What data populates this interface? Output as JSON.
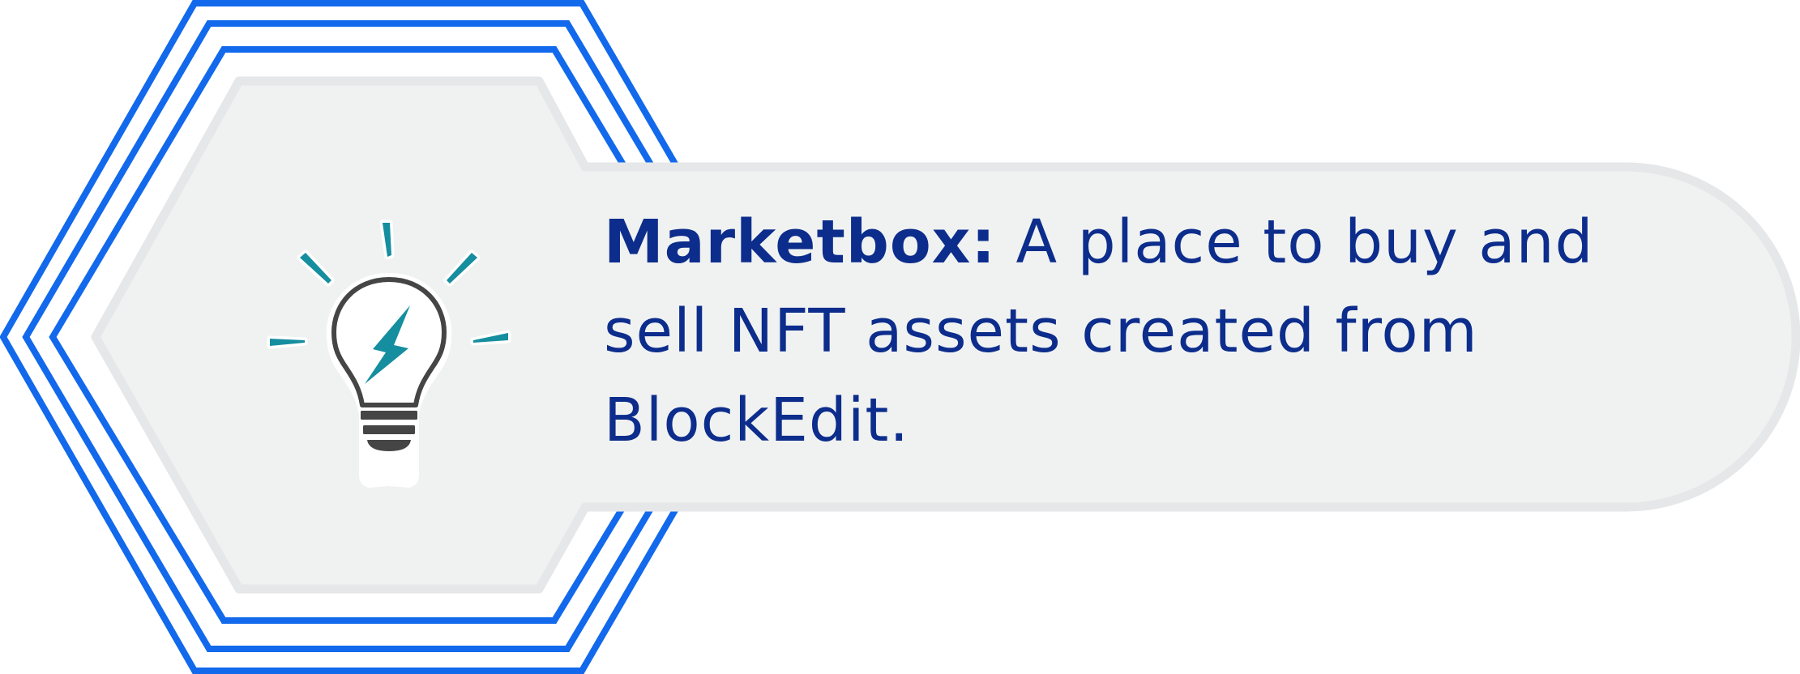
{
  "callout": {
    "term": "Marketbox",
    "separator": ":",
    "description": " A place to buy and sell NFT assets created from BlockEdit."
  },
  "icons": {
    "main": "lightbulb-icon",
    "inner": "lightning-bolt-icon",
    "rays": "light-ray-icon"
  },
  "colors": {
    "frame_blue": "#1269ec",
    "panel_fill": "#f0f2f2",
    "panel_border": "#e5e7e9",
    "text_navy": "#0d2d8c",
    "accent_teal": "#158e9f",
    "bulb_outline": "#454545"
  }
}
